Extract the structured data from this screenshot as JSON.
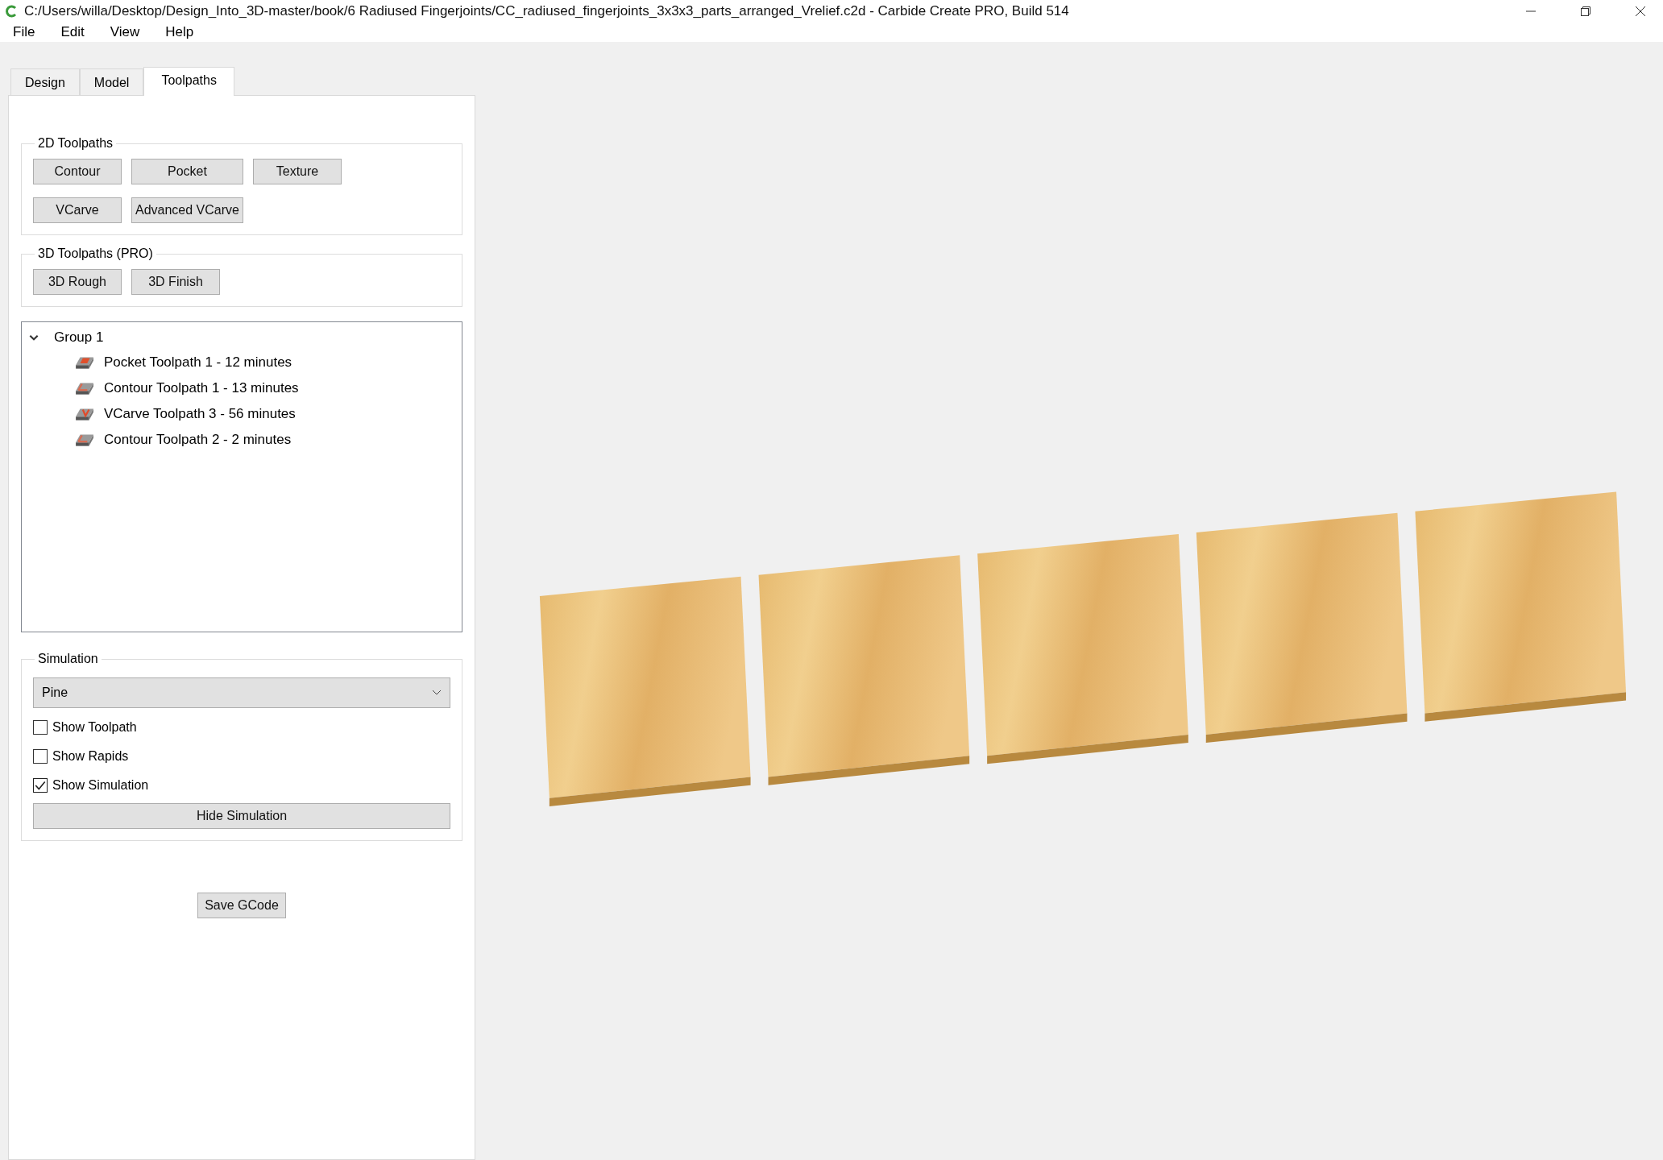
{
  "window": {
    "title": "C:/Users/willa/Desktop/Design_Into_3D-master/book/6 Radiused Fingerjoints/CC_radiused_fingerjoints_3x3x3_parts_arranged_Vrelief.c2d - Carbide Create PRO, Build 514"
  },
  "menu": [
    "File",
    "Edit",
    "View",
    "Help"
  ],
  "tabs": [
    {
      "label": "Design",
      "selected": false
    },
    {
      "label": "Model",
      "selected": false
    },
    {
      "label": "Toolpaths",
      "selected": true
    }
  ],
  "toolpaths_2d": {
    "title": "2D Toolpaths",
    "buttons": [
      "Contour",
      "Pocket",
      "Texture",
      "VCarve",
      "Advanced VCarve"
    ]
  },
  "toolpaths_3d": {
    "title": "3D Toolpaths (PRO)",
    "buttons": [
      "3D Rough",
      "3D Finish"
    ]
  },
  "tree": [
    {
      "label": "Group 1",
      "expanded": true,
      "children": [
        {
          "label": "Pocket Toolpath 1 - 12 minutes",
          "kind": "pocket"
        },
        {
          "label": "Contour Toolpath 1 - 13 minutes",
          "kind": "contour"
        },
        {
          "label": "VCarve Toolpath 3 - 56 minutes",
          "kind": "vcarve"
        },
        {
          "label": "Contour Toolpath 2 - 2 minutes",
          "kind": "contour"
        }
      ]
    }
  ],
  "simulation": {
    "title": "Simulation",
    "material": "Pine",
    "options": [
      {
        "label": "Show Toolpath",
        "checked": false
      },
      {
        "label": "Show Rapids",
        "checked": false
      },
      {
        "label": "Show Simulation",
        "checked": true
      }
    ],
    "button": "Hide Simulation"
  },
  "save_button": "Save GCode"
}
